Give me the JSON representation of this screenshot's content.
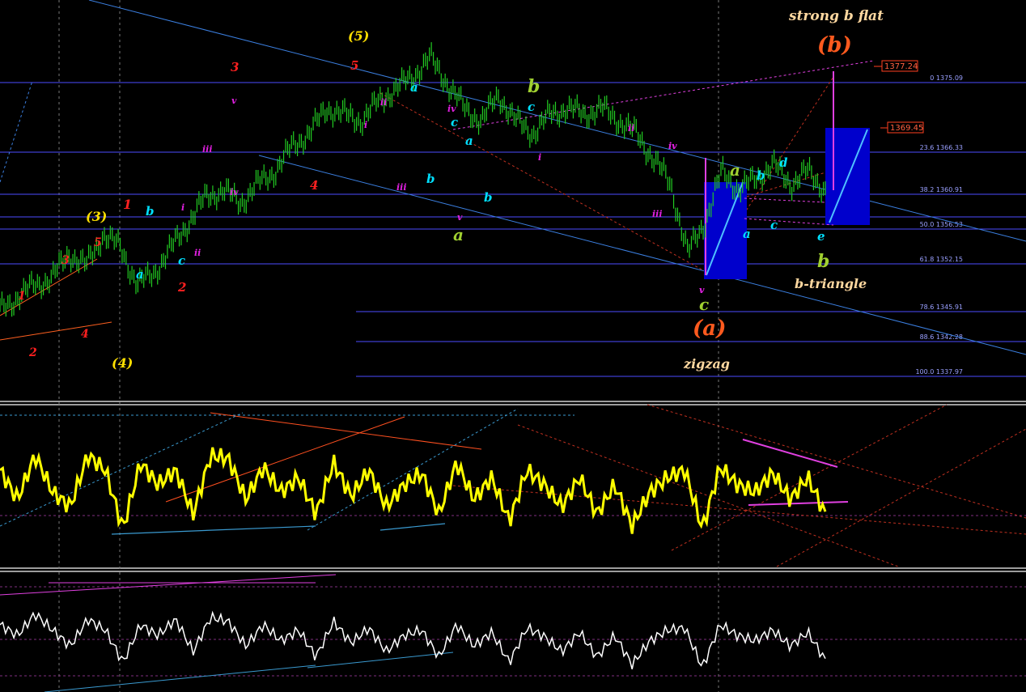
{
  "colors": {
    "background": "#000000",
    "price_bars": "#22cc22",
    "fib_lines": "#4d4dff",
    "channel_lines": "#3b7fe0",
    "oscillator_1": "#ffff00",
    "oscillator_2": "#ffffff",
    "projection": "#e040e0",
    "box_fill": "#0000cc"
  },
  "fib_levels": [
    {
      "ratio": "0",
      "price": "1375.09"
    },
    {
      "ratio": "23.6",
      "price": "1366.33"
    },
    {
      "ratio": "38.2",
      "price": "1360.91"
    },
    {
      "ratio": "50.0",
      "price": "1356.53"
    },
    {
      "ratio": "61.8",
      "price": "1352.15"
    },
    {
      "ratio": "78.6",
      "price": "1345.91"
    },
    {
      "ratio": "88.6",
      "price": "1342.28"
    },
    {
      "ratio": "100.0",
      "price": "1337.97"
    }
  ],
  "price_tags": [
    "1377.24",
    "1369.45"
  ],
  "annotations": {
    "strong_b_flat": "strong b flat",
    "b_paren": "(b)",
    "a_paren": "(a)",
    "zigzag": "zigzag",
    "b_triangle": "b-triangle"
  },
  "wave_labels": [
    {
      "t": "1",
      "c": "#ff2020"
    },
    {
      "t": "2",
      "c": "#ff2020"
    },
    {
      "t": "3",
      "c": "#ff2020"
    },
    {
      "t": "4",
      "c": "#ff2020"
    },
    {
      "t": "5",
      "c": "#ff2020"
    },
    {
      "t": "(3)",
      "c": "#ffe000"
    },
    {
      "t": "(4)",
      "c": "#ffe000"
    },
    {
      "t": "(5)",
      "c": "#ffe000"
    },
    {
      "t": "1",
      "c": "#ff2020"
    },
    {
      "t": "2",
      "c": "#ff2020"
    },
    {
      "t": "3",
      "c": "#ff2020"
    },
    {
      "t": "4",
      "c": "#ff2020"
    },
    {
      "t": "5",
      "c": "#ff2020"
    },
    {
      "t": "a",
      "c": "#00e0ff"
    },
    {
      "t": "b",
      "c": "#00e0ff"
    },
    {
      "t": "c",
      "c": "#00e0ff"
    },
    {
      "t": "i",
      "c": "#e020e0"
    },
    {
      "t": "ii",
      "c": "#e020e0"
    },
    {
      "t": "iii",
      "c": "#e020e0"
    },
    {
      "t": "iv",
      "c": "#e020e0"
    },
    {
      "t": "v",
      "c": "#e020e0"
    },
    {
      "t": "i",
      "c": "#e020e0"
    },
    {
      "t": "ii",
      "c": "#e020e0"
    },
    {
      "t": "iii",
      "c": "#e020e0"
    },
    {
      "t": "iv",
      "c": "#e020e0"
    },
    {
      "t": "v",
      "c": "#e020e0"
    },
    {
      "t": "a",
      "c": "#00e0ff"
    },
    {
      "t": "b",
      "c": "#00e0ff"
    },
    {
      "t": "c",
      "c": "#00e0ff"
    },
    {
      "t": "a",
      "c": "#00e0ff"
    },
    {
      "t": "b",
      "c": "#00e0ff"
    },
    {
      "t": "c",
      "c": "#00e0ff"
    },
    {
      "t": "a",
      "c": "#a0d030"
    },
    {
      "t": "b",
      "c": "#a0d030"
    },
    {
      "t": "iv",
      "c": "#e020e0"
    },
    {
      "t": "v",
      "c": "#e020e0"
    },
    {
      "t": "i",
      "c": "#e020e0"
    },
    {
      "t": "ii",
      "c": "#e020e0"
    },
    {
      "t": "iii",
      "c": "#e020e0"
    },
    {
      "t": "iv",
      "c": "#e020e0"
    },
    {
      "t": "v",
      "c": "#e020e0"
    },
    {
      "t": "a",
      "c": "#a0d030"
    },
    {
      "t": "c",
      "c": "#a0d030"
    },
    {
      "t": "a",
      "c": "#00e0ff"
    },
    {
      "t": "b",
      "c": "#00e0ff"
    },
    {
      "t": "c",
      "c": "#00e0ff"
    },
    {
      "t": "d",
      "c": "#00e0ff"
    },
    {
      "t": "e",
      "c": "#00e0ff"
    },
    {
      "t": "b",
      "c": "#a0d030"
    }
  ],
  "chart_data": [
    {
      "type": "line",
      "panel": "price",
      "title": "",
      "series": [
        {
          "values": [
            1336,
            1338,
            1340,
            1341,
            1345,
            1343,
            1348,
            1346,
            1340,
            1342,
            1346,
            1350,
            1354,
            1355,
            1353,
            1356,
            1358,
            1362,
            1364,
            1368,
            1367,
            1366,
            1369,
            1371,
            1373,
            1376,
            1372,
            1368,
            1366,
            1370,
            1366,
            1364,
            1367,
            1368,
            1367,
            1368,
            1366,
            1364,
            1360,
            1356,
            1345,
            1350,
            1358,
            1355,
            1357,
            1359,
            1356,
            1358,
            1355
          ]
        }
      ]
    },
    {
      "type": "line",
      "panel": "oscillator_1",
      "series": [
        {
          "values": [
            60,
            40,
            70,
            45,
            35,
            70,
            60,
            20,
            65,
            50,
            60,
            30,
            70,
            68,
            40,
            62,
            45,
            55,
            30,
            65,
            42,
            60,
            35,
            50,
            58,
            30,
            65,
            40,
            55,
            25,
            60,
            50,
            35,
            55,
            30,
            50,
            22,
            45,
            55,
            60,
            20,
            62,
            50,
            45,
            58,
            40,
            55,
            30
          ]
        }
      ]
    },
    {
      "type": "line",
      "panel": "oscillator_2",
      "series": [
        {
          "values": [
            55,
            45,
            65,
            50,
            35,
            60,
            50,
            20,
            55,
            45,
            60,
            30,
            62,
            58,
            35,
            55,
            40,
            50,
            25,
            58,
            38,
            52,
            30,
            45,
            50,
            25,
            55,
            35,
            48,
            20,
            52,
            44,
            30,
            48,
            25,
            45,
            18,
            40,
            50,
            52,
            15,
            55,
            45,
            40,
            50,
            35,
            48,
            22
          ]
        }
      ]
    }
  ]
}
